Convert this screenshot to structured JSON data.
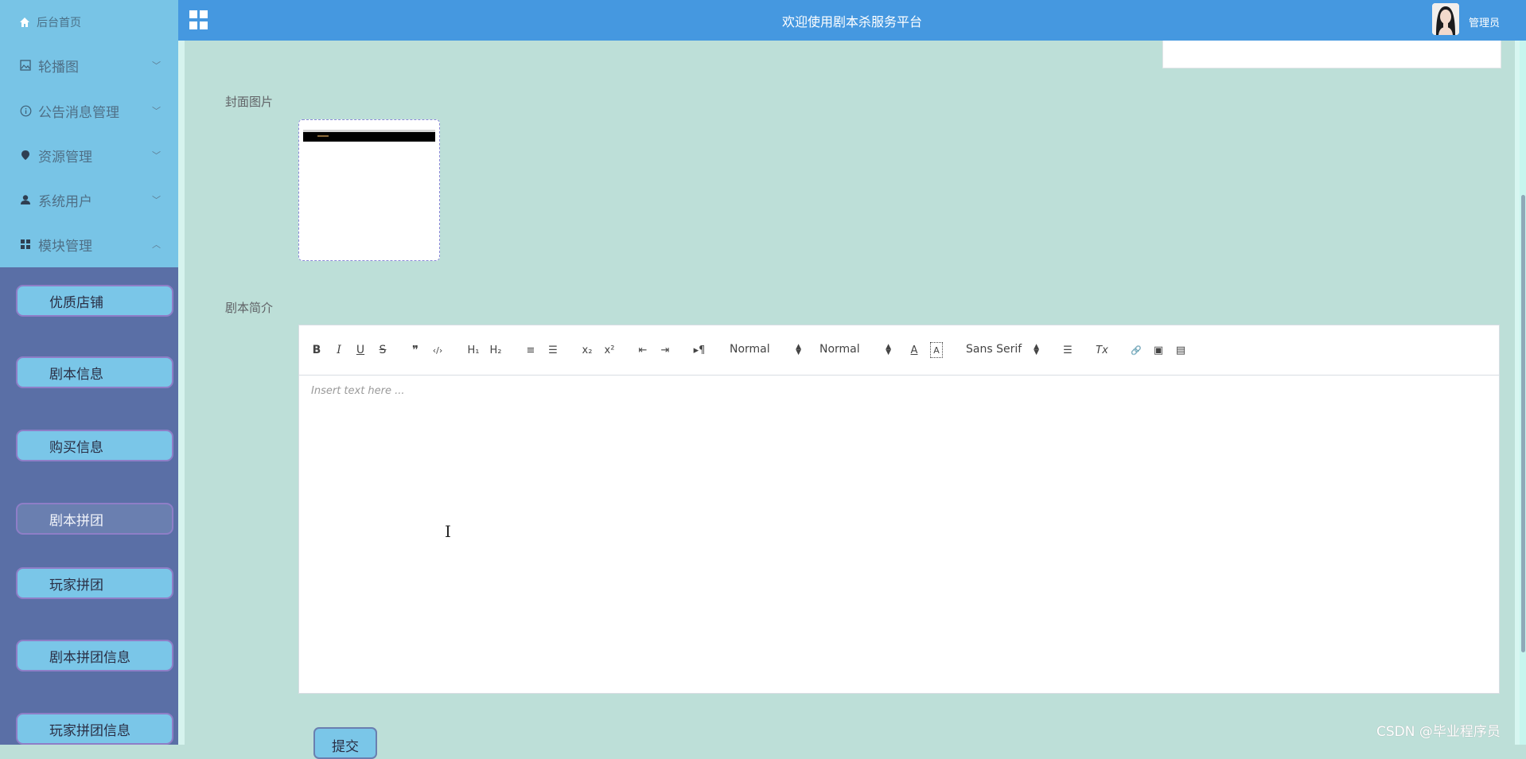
{
  "sidebar": {
    "home_label": "后台首页",
    "menu": [
      {
        "label": "轮播图",
        "icon": "image-icon",
        "chevron": "﹀"
      },
      {
        "label": "公告消息管理",
        "icon": "info-icon",
        "chevron": "﹀"
      },
      {
        "label": "资源管理",
        "icon": "location-icon",
        "chevron": "﹀"
      },
      {
        "label": "系统用户",
        "icon": "user-icon",
        "chevron": "﹀"
      },
      {
        "label": "模块管理",
        "icon": "grid-icon",
        "chevron": "︿"
      }
    ],
    "submenu": [
      {
        "label": "优质店铺",
        "active": false
      },
      {
        "label": "剧本信息",
        "active": false
      },
      {
        "label": "购买信息",
        "active": false
      },
      {
        "label": "剧本拼团",
        "active": true
      },
      {
        "label": "玩家拼团",
        "active": false
      },
      {
        "label": "剧本拼团信息",
        "active": false
      },
      {
        "label": "玩家拼团信息",
        "active": false
      }
    ]
  },
  "header": {
    "title": "欢迎使用剧本杀服务平台",
    "user_name": "管理员"
  },
  "form": {
    "cover_label": "封面图片",
    "intro_label": "剧本简介",
    "submit_label": "提交"
  },
  "editor": {
    "placeholder": "Insert text here ...",
    "header_select": "Normal",
    "size_select": "Normal",
    "font_select": "Sans Serif",
    "tools": {
      "bold": "B",
      "italic": "I",
      "underline": "U",
      "strike": "S",
      "quote": "❞",
      "code": "‹/›",
      "h1": "H₁",
      "h2": "H₂",
      "ordered": "≡",
      "bullet": "☰",
      "sub": "x₂",
      "sup": "x²",
      "outdent": "⇤",
      "indent": "⇥",
      "direction": "▸¶",
      "color": "A",
      "background": "A",
      "align": "☰",
      "clean": "Tx",
      "link": "🔗",
      "image": "▣",
      "video": "▤"
    }
  },
  "watermark": "CSDN @毕业程序员",
  "colors": {
    "header_bg": "#4598e0",
    "sidebar_top": "#78c4e6",
    "sidebar_bottom": "#5a6fa6",
    "content_bg": "#bddfd8"
  }
}
